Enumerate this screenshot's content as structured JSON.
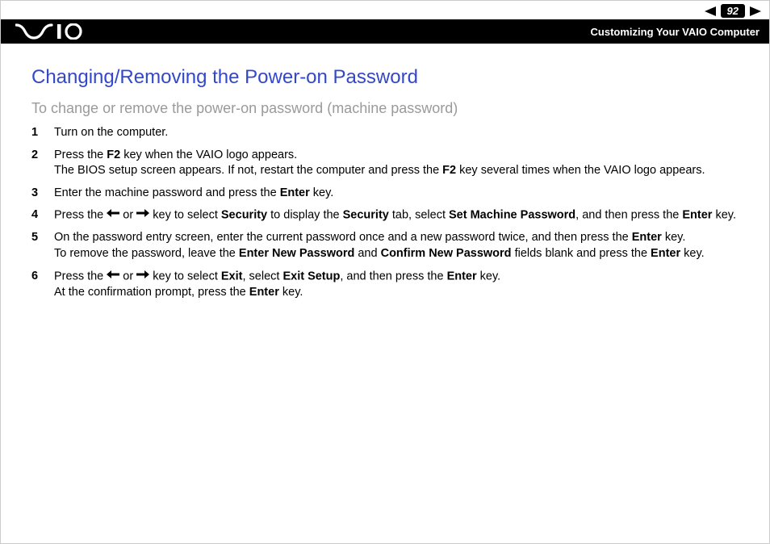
{
  "nav": {
    "page_number": "92"
  },
  "header": {
    "section": "Customizing Your VAIO Computer"
  },
  "content": {
    "title": "Changing/Removing the Power-on Password",
    "subtitle": "To change or remove the power-on password (machine password)",
    "steps": [
      {
        "num": "1",
        "segments": [
          {
            "t": "Turn on the computer."
          }
        ]
      },
      {
        "num": "2",
        "segments": [
          {
            "t": "Press the "
          },
          {
            "t": "F2",
            "b": true
          },
          {
            "t": " key when the VAIO logo appears."
          },
          {
            "br": true
          },
          {
            "t": "The BIOS setup screen appears. If not, restart the computer and press the "
          },
          {
            "t": "F2",
            "b": true
          },
          {
            "t": " key several times when the VAIO logo appears."
          }
        ]
      },
      {
        "num": "3",
        "segments": [
          {
            "t": "Enter the machine password and press the "
          },
          {
            "t": "Enter",
            "b": true
          },
          {
            "t": " key."
          }
        ]
      },
      {
        "num": "4",
        "segments": [
          {
            "t": "Press the "
          },
          {
            "arrow": "left"
          },
          {
            "t": " or "
          },
          {
            "arrow": "right"
          },
          {
            "t": " key to select "
          },
          {
            "t": "Security",
            "b": true
          },
          {
            "t": " to display the "
          },
          {
            "t": "Security",
            "b": true
          },
          {
            "t": " tab, select "
          },
          {
            "t": "Set Machine Password",
            "b": true
          },
          {
            "t": ", and then press the "
          },
          {
            "t": "Enter",
            "b": true
          },
          {
            "t": " key."
          }
        ]
      },
      {
        "num": "5",
        "segments": [
          {
            "t": "On the password entry screen, enter the current password once and a new password twice, and then press the "
          },
          {
            "t": "Enter",
            "b": true
          },
          {
            "t": " key."
          },
          {
            "br": true
          },
          {
            "t": "To remove the password, leave the "
          },
          {
            "t": "Enter New Password",
            "b": true
          },
          {
            "t": " and "
          },
          {
            "t": "Confirm New Password",
            "b": true
          },
          {
            "t": " fields blank and press the "
          },
          {
            "t": "Enter",
            "b": true
          },
          {
            "t": " key."
          }
        ]
      },
      {
        "num": "6",
        "segments": [
          {
            "t": "Press the "
          },
          {
            "arrow": "left"
          },
          {
            "t": " or "
          },
          {
            "arrow": "right"
          },
          {
            "t": " key to select "
          },
          {
            "t": "Exit",
            "b": true
          },
          {
            "t": ", select "
          },
          {
            "t": "Exit Setup",
            "b": true
          },
          {
            "t": ", and then press the "
          },
          {
            "t": "Enter",
            "b": true
          },
          {
            "t": " key."
          },
          {
            "br": true
          },
          {
            "t": "At the confirmation prompt, press the "
          },
          {
            "t": "Enter",
            "b": true
          },
          {
            "t": " key."
          }
        ]
      }
    ]
  }
}
